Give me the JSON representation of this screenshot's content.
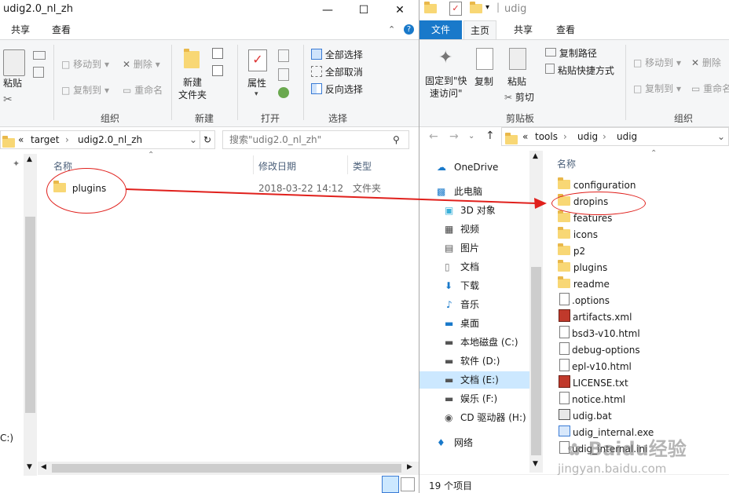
{
  "left": {
    "title": "udig2.0_nl_zh",
    "tabs": [
      "共享",
      "查看"
    ],
    "ribbon": {
      "paste": "粘贴",
      "move_to": "移动到",
      "copy_to": "复制到",
      "delete": "删除",
      "rename": "重命名",
      "organize": "组织",
      "new_folder": "新建\n文件夹",
      "new": "新建",
      "properties": "属性",
      "open": "打开",
      "select_all": "全部选择",
      "select_none": "全部取消",
      "invert_selection": "反向选择",
      "select": "选择"
    },
    "address": {
      "prefix": "«",
      "crumbs": [
        "target",
        "udig2.0_nl_zh"
      ]
    },
    "search_placeholder": "搜索\"udig2.0_nl_zh\"",
    "columns": {
      "name": "名称",
      "modified": "修改日期",
      "type": "类型"
    },
    "files": [
      {
        "name": "plugins",
        "modified": "2018-03-22 14:12",
        "type": "文件夹"
      }
    ],
    "nav_fragment": "C:)"
  },
  "right": {
    "title": "udig",
    "tabs": {
      "file": "文件",
      "home": "主页",
      "share": "共享",
      "view": "查看"
    },
    "ribbon": {
      "pin": "固定到\"快\n速访问\"",
      "copy": "复制",
      "paste": "粘贴",
      "copy_path": "复制路径",
      "paste_shortcut": "粘贴快捷方式",
      "cut": "剪切",
      "clipboard": "剪贴板",
      "move_to": "移动到",
      "copy_to": "复制到",
      "delete": "删除",
      "rename": "重命名",
      "organize": "组织"
    },
    "address": {
      "prefix": "«",
      "crumbs": [
        "tools",
        "udig",
        "udig"
      ]
    },
    "column_name": "名称",
    "nav": [
      {
        "label": "OneDrive",
        "icon": "cloud-icon"
      },
      {
        "label": "此电脑",
        "icon": "computer-icon"
      },
      {
        "label": "3D 对象",
        "icon": "cube-icon"
      },
      {
        "label": "视频",
        "icon": "video-icon"
      },
      {
        "label": "图片",
        "icon": "picture-icon"
      },
      {
        "label": "文档",
        "icon": "document-icon"
      },
      {
        "label": "下载",
        "icon": "download-icon"
      },
      {
        "label": "音乐",
        "icon": "music-icon"
      },
      {
        "label": "桌面",
        "icon": "desktop-icon"
      },
      {
        "label": "本地磁盘 (C:)",
        "icon": "drive-icon"
      },
      {
        "label": "软件 (D:)",
        "icon": "drive-icon"
      },
      {
        "label": "文档 (E:)",
        "icon": "drive-icon"
      },
      {
        "label": "娱乐 (F:)",
        "icon": "drive-icon"
      },
      {
        "label": "CD 驱动器 (H:)",
        "icon": "cd-drive-icon"
      },
      {
        "label": "网络",
        "icon": "network-icon"
      }
    ],
    "files": [
      {
        "name": "configuration",
        "kind": "folder"
      },
      {
        "name": "dropins",
        "kind": "folder"
      },
      {
        "name": "features",
        "kind": "folder"
      },
      {
        "name": "icons",
        "kind": "folder"
      },
      {
        "name": "p2",
        "kind": "folder"
      },
      {
        "name": "plugins",
        "kind": "folder"
      },
      {
        "name": "readme",
        "kind": "folder"
      },
      {
        "name": ".options",
        "kind": "doc"
      },
      {
        "name": "artifacts.xml",
        "kind": "xml"
      },
      {
        "name": "bsd3-v10.html",
        "kind": "doc"
      },
      {
        "name": "debug-options",
        "kind": "doc"
      },
      {
        "name": "epl-v10.html",
        "kind": "doc"
      },
      {
        "name": "LICENSE.txt",
        "kind": "xml"
      },
      {
        "name": "notice.html",
        "kind": "doc"
      },
      {
        "name": "udig.bat",
        "kind": "bat"
      },
      {
        "name": "udig_internal.exe",
        "kind": "exe"
      },
      {
        "name": "udig_internal.ini",
        "kind": "doc"
      }
    ],
    "status": "19 个项目"
  },
  "watermark": {
    "logo": "Baidu经验",
    "url": "jingyan.baidu.com"
  },
  "colors": {
    "accent": "#1979ca",
    "annotation": "#e0201c",
    "folder": "#f8d775"
  }
}
